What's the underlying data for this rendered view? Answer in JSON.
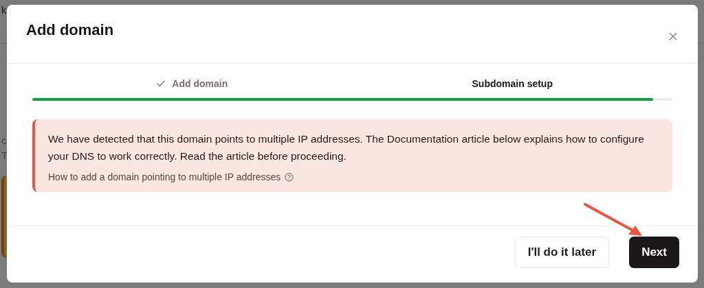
{
  "background": {
    "header_text": "k",
    "paragraph_lines": [
      "c",
      "T"
    ]
  },
  "dialog": {
    "title": "Add domain",
    "steps": [
      {
        "label": "Add domain",
        "completed": true,
        "selected": false
      },
      {
        "label": "Subdomain setup",
        "completed": false,
        "selected": true
      }
    ],
    "progress": {
      "level": 0.97
    },
    "alert": {
      "message": "We have detected that this domain points to multiple IP addresses. The Documentation article below explains how to configure your DNS to work correctly. Read the article before proceeding.",
      "link": "How to add a domain pointing to multiple IP addresses"
    },
    "buttons": [
      {
        "label": "I'll do it later",
        "kind": "secondary"
      },
      {
        "label": "Next",
        "kind": "primary"
      }
    ]
  }
}
